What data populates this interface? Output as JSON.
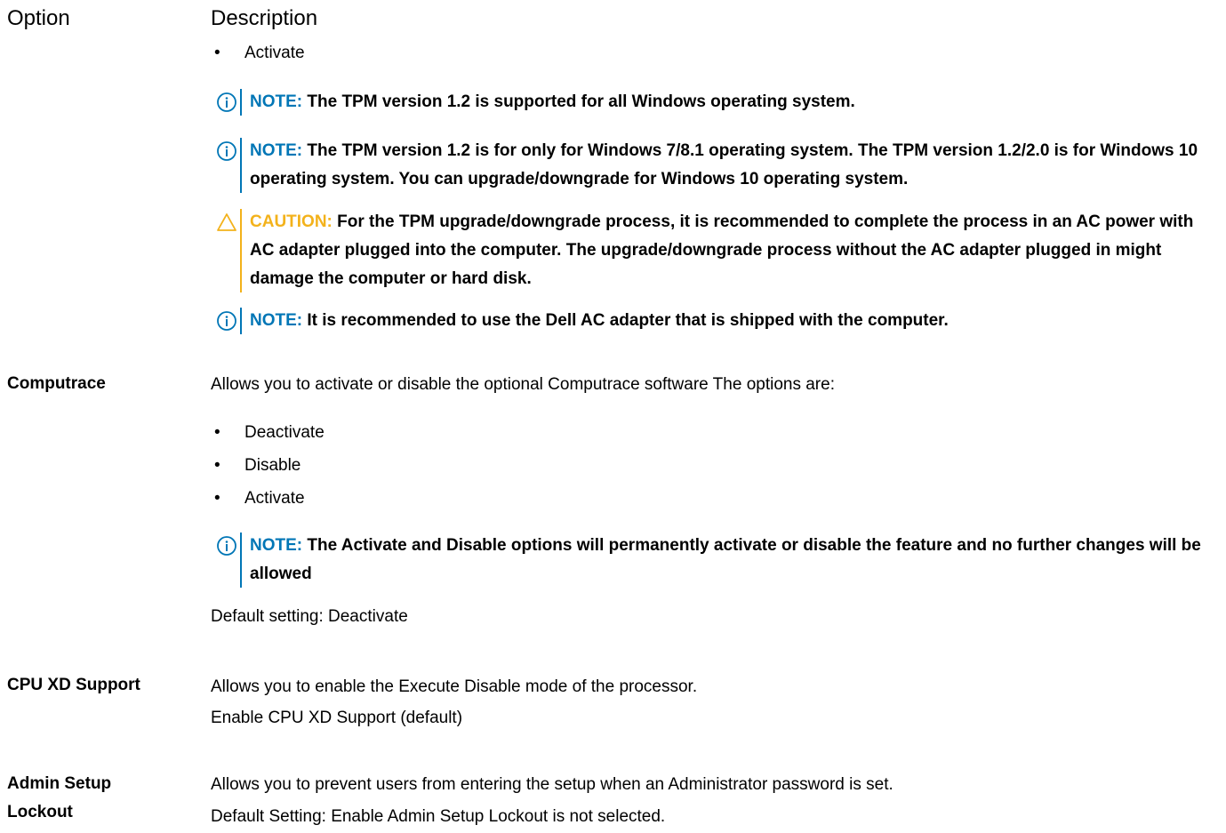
{
  "header": {
    "option": "Option",
    "description": "Description"
  },
  "tpm": {
    "bullets": [
      "Activate"
    ],
    "notes": [
      {
        "kind": "note",
        "label": "NOTE:",
        "text": "The TPM version 1.2 is supported for all Windows operating system."
      },
      {
        "kind": "note",
        "label": "NOTE:",
        "text": "The TPM version 1.2 is for only for Windows 7/8.1 operating system. The TPM version 1.2/2.0 is for Windows 10 operating system. You can upgrade/downgrade for Windows 10 operating system."
      },
      {
        "kind": "caution",
        "label": "CAUTION:",
        "text": "For the TPM upgrade/downgrade process, it is recommended to complete the process in an AC power with AC adapter plugged into the computer. The upgrade/downgrade process without the AC adapter plugged in might damage the computer or hard disk."
      },
      {
        "kind": "note",
        "label": "NOTE:",
        "text": "It is recommended to use the Dell AC adapter that is shipped with the computer."
      }
    ]
  },
  "computrace": {
    "option": "Computrace",
    "intro": "Allows you to activate or disable the optional Computrace software The options are:",
    "bullets": [
      "Deactivate",
      "Disable",
      "Activate"
    ],
    "note": {
      "label": "NOTE:",
      "text": "The Activate and Disable options will permanently activate or disable the feature and no further changes will be allowed"
    },
    "default": "Default setting: Deactivate"
  },
  "cpu_xd": {
    "option": "CPU XD Support",
    "line1": "Allows you to enable the Execute Disable mode of the processor.",
    "line2": "Enable CPU XD Support (default)"
  },
  "admin_lockout": {
    "option_line1": "Admin Setup",
    "option_line2": "Lockout",
    "line1": "Allows you to prevent users from entering the setup when an Administrator password is set.",
    "line2": "Default Setting: Enable Admin Setup Lockout is not selected."
  },
  "colors": {
    "note": "#0076b6",
    "caution": "#f3b21b",
    "text": "#000000"
  },
  "icons": {
    "note": "info-circle-icon",
    "caution": "warning-triangle-icon"
  }
}
